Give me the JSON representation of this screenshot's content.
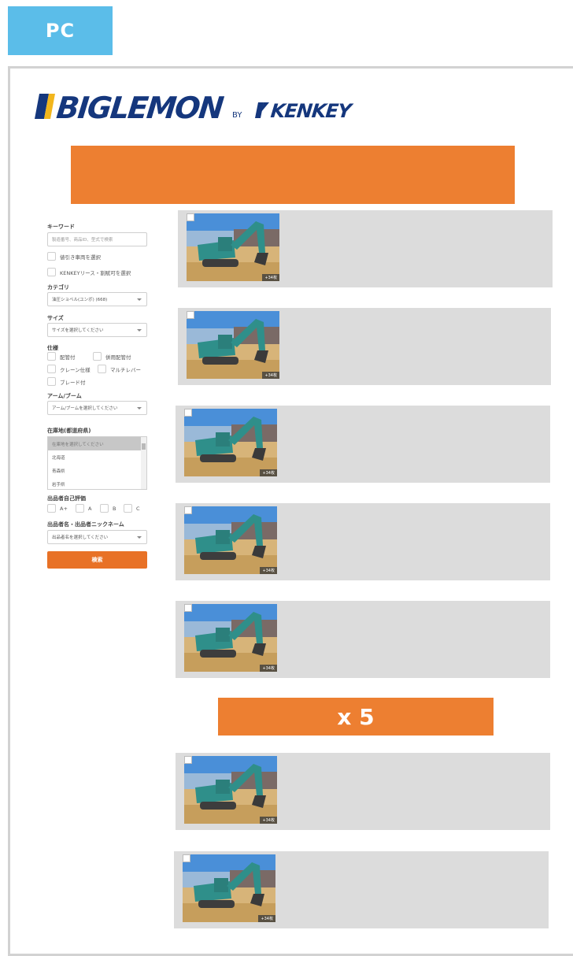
{
  "tag": "PC",
  "logo": {
    "brand": "BIGLEMON",
    "by": "BY",
    "partner": "KENKEY"
  },
  "sidebar": {
    "keyword_label": "キーワード",
    "keyword_placeholder": "製造番号、商品ID、型式で検索",
    "discount_check": "値引き車両を選択",
    "lease_check": "KENKEYリース・割賦可を選択",
    "category_label": "カテゴリ",
    "category_value": "油圧ショベル(ユンボ) (668)",
    "size_label": "サイズ",
    "size_value": "サイズを選択してください",
    "spec_label": "仕様",
    "spec_options": [
      "配管付",
      "併用配管付",
      "クレーン仕様",
      "マルチレバー",
      "ブレード付"
    ],
    "arm_label": "アーム/ブーム",
    "arm_value": "アーム/ブームを選択してください",
    "location_label": "在庫地(都道府県)",
    "location_options": [
      "在庫地を選択してください",
      "北海道",
      "青森県",
      "岩手県"
    ],
    "rating_label": "出品者自己評価",
    "rating_options": [
      "A+",
      "A",
      "B",
      "C"
    ],
    "seller_label": "出品者名・出品者ニックネーム",
    "seller_value": "出品者名を選択してください",
    "search_button": "検索"
  },
  "listings": [
    {
      "photo_count": "+34枚"
    },
    {
      "photo_count": "+34枚"
    },
    {
      "photo_count": "+34枚"
    },
    {
      "photo_count": "+34枚"
    },
    {
      "photo_count": "+34枚"
    },
    {
      "photo_count": "+34枚"
    },
    {
      "photo_count": "+34枚"
    }
  ],
  "repeat_label": "x 5",
  "colors": {
    "accent": "#ed7f31",
    "tag": "#5bbde9",
    "brand": "#15377d",
    "card": "#dcdcdc"
  }
}
